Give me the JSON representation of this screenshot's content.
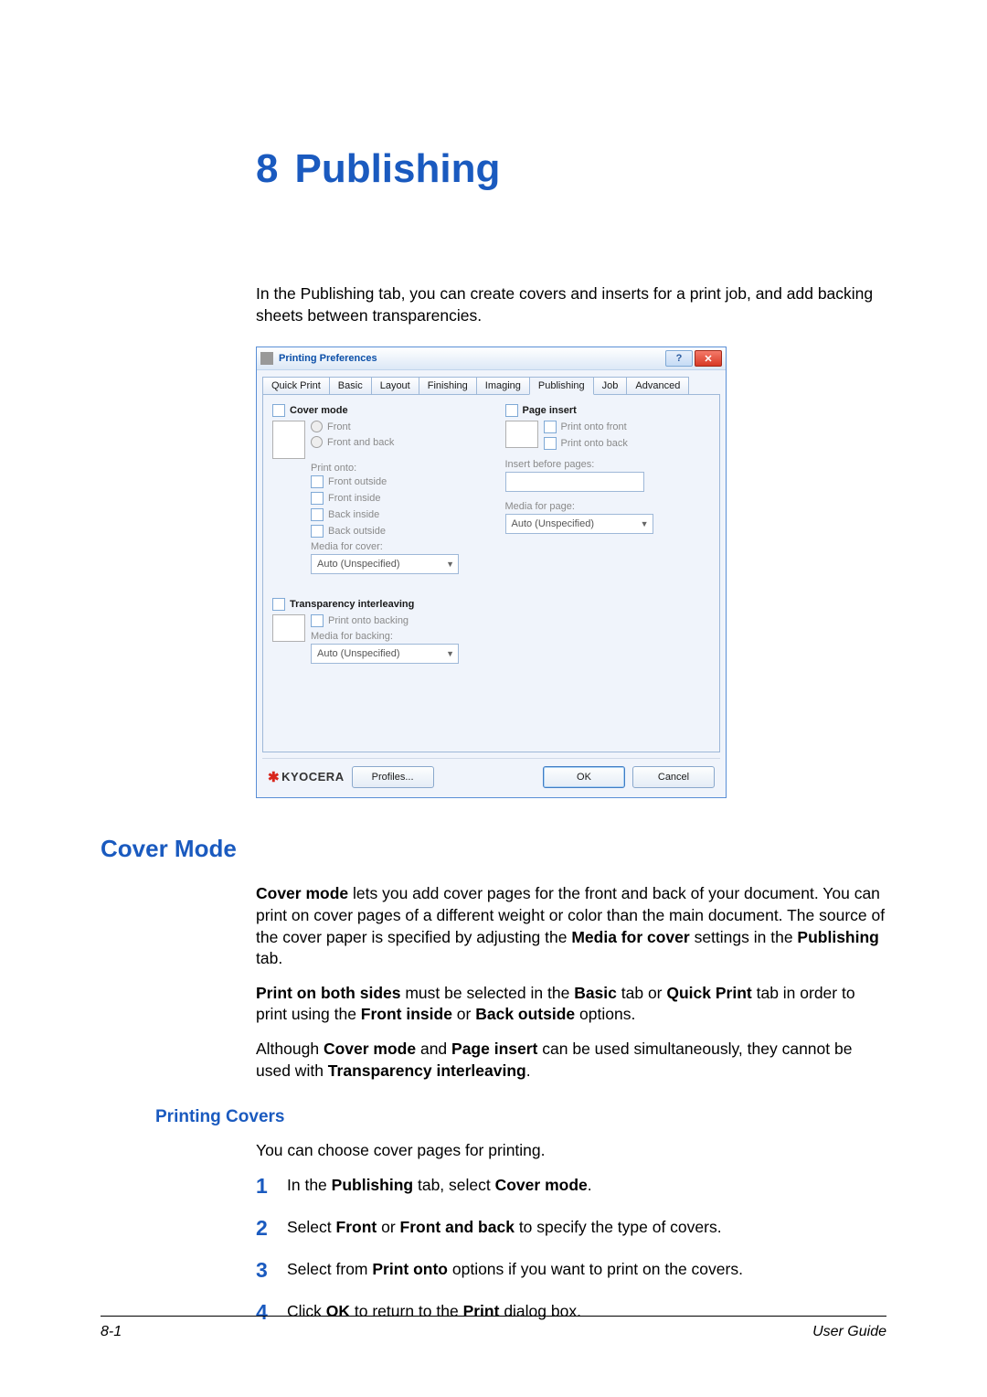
{
  "chapter": {
    "number": "8",
    "title": "Publishing"
  },
  "intro": "In the Publishing tab, you can create covers and inserts for a print job, and add backing sheets between transparencies.",
  "dialog": {
    "title": "Printing Preferences",
    "tabs": [
      "Quick Print",
      "Basic",
      "Layout",
      "Finishing",
      "Imaging",
      "Publishing",
      "Job",
      "Advanced"
    ],
    "activeTab": "Publishing",
    "coverMode": {
      "label": "Cover mode",
      "front": "Front",
      "frontAndBack": "Front and back",
      "printOnto": "Print onto:",
      "frontOutside": "Front outside",
      "frontInside": "Front inside",
      "backInside": "Back inside",
      "backOutside": "Back outside",
      "mediaForCover": "Media for cover:",
      "mediaValue": "Auto (Unspecified)"
    },
    "pageInsert": {
      "label": "Page insert",
      "printOntoFront": "Print onto front",
      "printOntoBack": "Print onto back",
      "insertBefore": "Insert before pages:",
      "mediaForPage": "Media for page:",
      "mediaValue": "Auto (Unspecified)"
    },
    "transparency": {
      "label": "Transparency interleaving",
      "printOntoBacking": "Print onto backing",
      "mediaForBacking": "Media for backing:",
      "mediaValue": "Auto (Unspecified)"
    },
    "logo": "KYOCERA",
    "buttons": {
      "profiles": "Profiles...",
      "ok": "OK",
      "cancel": "Cancel"
    }
  },
  "section1": {
    "heading": "Cover Mode",
    "p1a": "Cover mode",
    "p1b": " lets you add cover pages for the front and back of your document. You can print on cover pages of a different weight or color than the main document. The source of the cover paper is specified by adjusting the ",
    "p1c": "Media for cover",
    "p1d": " settings in the ",
    "p1e": "Publishing",
    "p1f": " tab.",
    "p2a": "Print on both sides",
    "p2b": " must be selected in the ",
    "p2c": "Basic",
    "p2d": " tab or ",
    "p2e": "Quick Print",
    "p2f": " tab in order to print using the ",
    "p2g": "Front inside",
    "p2h": " or ",
    "p2i": "Back outside",
    "p2j": " options.",
    "p3a": "Although ",
    "p3b": "Cover mode",
    "p3c": " and ",
    "p3d": "Page insert",
    "p3e": " can be used simultaneously, they cannot be used with ",
    "p3f": "Transparency interleaving",
    "p3g": "."
  },
  "section2": {
    "heading": "Printing Covers",
    "intro": "You can choose cover pages for printing.",
    "steps": {
      "s1a": "In the ",
      "s1b": "Publishing",
      "s1c": " tab, select ",
      "s1d": "Cover mode",
      "s1e": ".",
      "s2a": "Select ",
      "s2b": "Front",
      "s2c": " or ",
      "s2d": "Front and back",
      "s2e": " to specify the type of covers.",
      "s3a": "Select from ",
      "s3b": "Print onto",
      "s3c": " options if you want to print on the covers.",
      "s4a": "Click ",
      "s4b": "OK",
      "s4c": " to return to the ",
      "s4d": "Print",
      "s4e": " dialog box."
    }
  },
  "footer": {
    "pageNum": "8-1",
    "guide": "User Guide"
  }
}
